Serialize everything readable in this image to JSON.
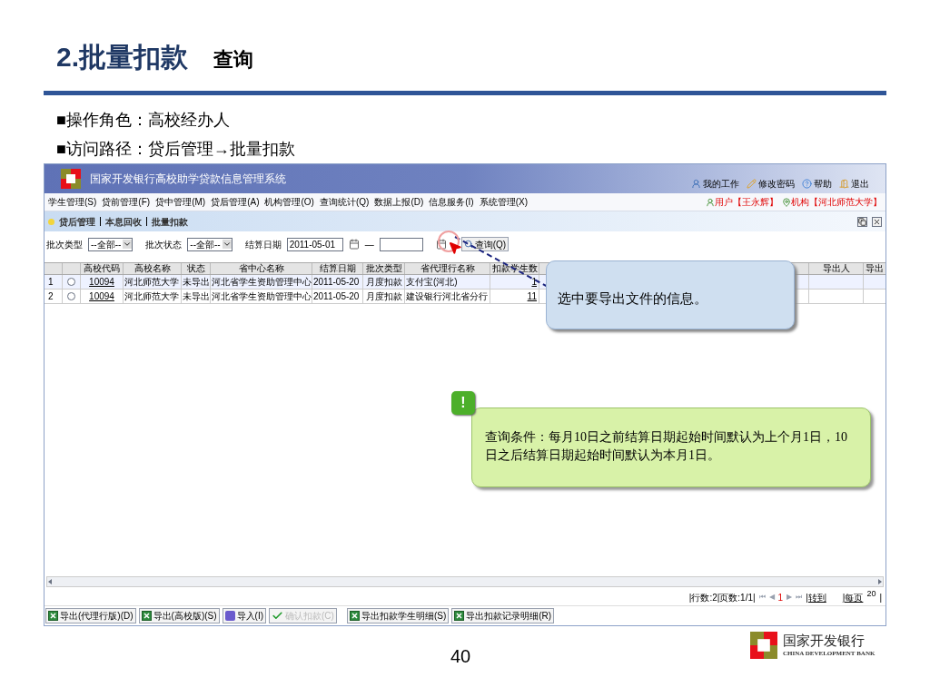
{
  "slide": {
    "title_number": "2.批量扣款",
    "title_sub": "查询",
    "bullets": [
      "■操作角色：高校经办人",
      "■访问路径：贷后管理→批量扣款"
    ],
    "page_number": "40",
    "logo": {
      "name_cn": "国家开发银行",
      "name_en": "CHINA DEVELOPMENT BANK"
    }
  },
  "app": {
    "title": "国家开发银行高校助学贷款信息管理系统",
    "top_links": [
      "我的工作",
      "修改密码",
      "帮助",
      "退出"
    ],
    "menu": [
      "学生管理(S)",
      "贷前管理(F)",
      "贷中管理(M)",
      "贷后管理(A)",
      "机构管理(O)",
      "查询统计(Q)",
      "数据上报(D)",
      "信息服务(I)",
      "系统管理(X)"
    ],
    "user": "用户【王永辉】",
    "org": "机构【河北师范大学】",
    "breadcrumb": [
      "贷后管理",
      "本息回收",
      "批量扣款"
    ],
    "filters": {
      "batch_type_label": "批次类型",
      "batch_type_value": "--全部--",
      "batch_status_label": "批次状态",
      "batch_status_value": "--全部--",
      "date_label": "结算日期",
      "date_from": "2011-05-01",
      "date_sep": "—",
      "query_button": "查询(Q)"
    },
    "table": {
      "columns": [
        "",
        "",
        "高校代码",
        "高校名称",
        "状态",
        "省中心名称",
        "结算日期",
        "批次类型",
        "省代理行名称",
        "扣款学生数",
        "导出人",
        "导出"
      ],
      "rows": [
        {
          "selected": false,
          "cells": [
            "1",
            "",
            "10094",
            "河北师范大学",
            "未导出",
            "河北省学生资助管理中心",
            "2011-05-20",
            "月度扣款",
            "支付宝(河北)",
            "1"
          ]
        },
        {
          "selected": false,
          "cells": [
            "2",
            "",
            "10094",
            "河北师范大学",
            "未导出",
            "河北省学生资助管理中心",
            "2011-05-20",
            "月度扣款",
            "建设银行河北省分行",
            "11"
          ]
        }
      ]
    },
    "paging": {
      "rows": "|行数:2|页数:1/1|",
      "first": "⏮",
      "prev": "◀",
      "current": "1",
      "next": "▶",
      "last": "⏭",
      "goto": "|转到",
      "per_page_label": "|每页",
      "per_page": "20",
      "end": "|"
    },
    "buttons": [
      {
        "label": "导出(代理行版)(D)",
        "kind": "excel",
        "disabled": false
      },
      {
        "label": "导出(高校版)(S)",
        "kind": "excel",
        "disabled": false
      },
      {
        "label": "导入(I)",
        "kind": "import",
        "disabled": false
      },
      {
        "label": "确认扣款(C)",
        "kind": "check",
        "disabled": true
      },
      {
        "label": "导出扣款学生明细(S)",
        "kind": "excel",
        "disabled": false
      },
      {
        "label": "导出扣款记录明细(R)",
        "kind": "excel",
        "disabled": false
      }
    ],
    "callouts": [
      {
        "text": "选中要导出文件的信息。",
        "kind": "plain"
      },
      {
        "text": "查询条件：每月10日之前结算日期起始时间默认为上个月1日，10日之后结算日期起始时间默认为本月1日。",
        "kind": "alert",
        "badge": "!"
      }
    ]
  }
}
